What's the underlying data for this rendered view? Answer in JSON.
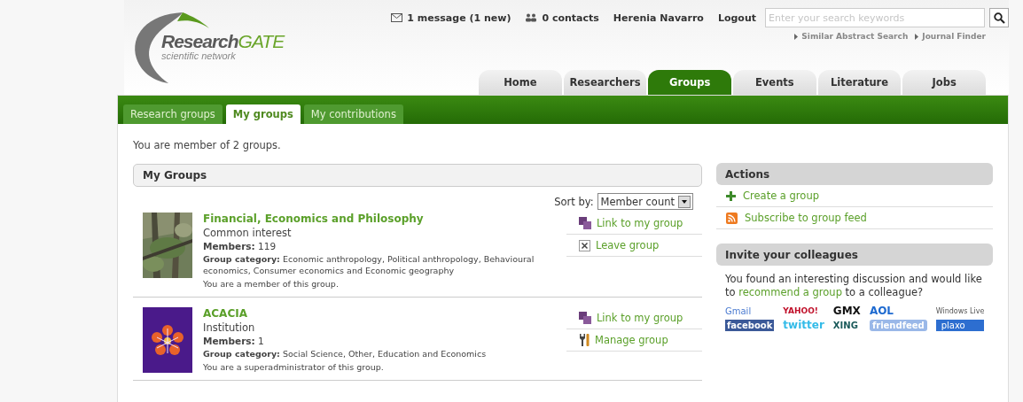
{
  "logo": {
    "name": "Research",
    "accent": "GATE",
    "tagline": "scientific network"
  },
  "top_links": [
    {
      "kind": "message",
      "label": "1 message (1 new)"
    },
    {
      "kind": "contacts",
      "label": "0 contacts"
    },
    {
      "kind": "plain",
      "label": "Herenia Navarro"
    },
    {
      "kind": "plain",
      "label": "Logout"
    }
  ],
  "search": {
    "placeholder": "Enter your search keywords"
  },
  "search_links": [
    "Similar Abstract Search",
    "Journal Finder"
  ],
  "tabs": [
    {
      "label": "Home",
      "selected": false
    },
    {
      "label": "Researchers",
      "selected": false
    },
    {
      "label": "Groups",
      "selected": true
    },
    {
      "label": "Events",
      "selected": false
    },
    {
      "label": "Literature",
      "selected": false
    },
    {
      "label": "Jobs",
      "selected": false
    }
  ],
  "subtabs": [
    {
      "label": "Research groups",
      "selected": false
    },
    {
      "label": "My groups",
      "selected": true
    },
    {
      "label": "My contributions",
      "selected": false
    }
  ],
  "summary": "You are member of 2 groups.",
  "groups_panel": {
    "title": "My Groups",
    "sort_label": "Sort by:",
    "sort_value": "Member count",
    "groups": [
      {
        "kind": "picture",
        "name": "Financial, Economics and Philosophy",
        "type": "Common interest",
        "members_label": "Members:",
        "members": "119",
        "category_label": "Group category:",
        "category": "Economic anthropology, Political anthropology, Behavioural economics, Consumer economics and Economic geography",
        "role": "You are a member of this group.",
        "actions": [
          {
            "kind": "link",
            "label": "Link to my group"
          },
          {
            "kind": "leave",
            "label": "Leave group"
          }
        ]
      },
      {
        "kind": "picture",
        "name": "ACACIA",
        "type": "Institution",
        "members_label": "Members:",
        "members": "1",
        "category_label": "Group category:",
        "category": "Social Science, Other, Education and Economics",
        "role": "You are a superadministrator of this group.",
        "actions": [
          {
            "kind": "link",
            "label": "Link to my group"
          },
          {
            "kind": "manage",
            "label": "Manage group"
          }
        ]
      }
    ]
  },
  "actions": {
    "title": "Actions",
    "items": [
      {
        "kind": "create",
        "label": "Create a group"
      },
      {
        "kind": "feed",
        "label": "Subscribe to group feed"
      }
    ]
  },
  "invite": {
    "title": "Invite your colleagues",
    "text_before": "You found an interesting discussion and would like to ",
    "link": "recommend a group",
    "text_after": " to a colleague?",
    "services": [
      {
        "kind": "gmail",
        "label": "Gmail"
      },
      {
        "kind": "yahoo",
        "label": "YAHOO!"
      },
      {
        "kind": "gmx",
        "label": "GMX"
      },
      {
        "kind": "aol",
        "label": "AOL"
      },
      {
        "kind": "live",
        "label": "Windows Live"
      },
      {
        "kind": "facebook",
        "label": "facebook"
      },
      {
        "kind": "twitter",
        "label": "twitter"
      },
      {
        "kind": "xing",
        "label": "XING"
      },
      {
        "kind": "friendfeed",
        "label": "friendfeed"
      },
      {
        "kind": "plaxo",
        "label": "plaxo"
      }
    ]
  }
}
